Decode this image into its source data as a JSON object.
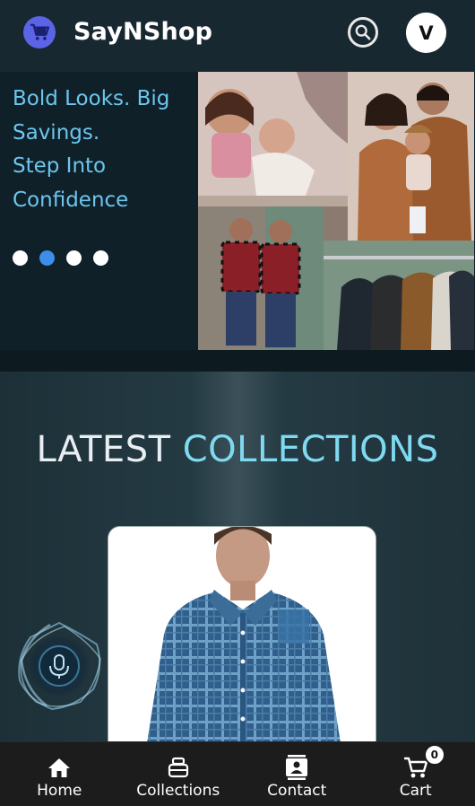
{
  "header": {
    "brand": "SayNShop",
    "avatar_initial": "V",
    "logo_icon": "cart-icon",
    "search_icon": "search-icon",
    "colors": {
      "logo_bg": "#5b63e6",
      "header_bg": "#172830"
    }
  },
  "hero": {
    "headline_lines": [
      "Bold Looks. Big",
      "Savings.",
      "Step Into",
      "Confidence"
    ],
    "carousel": {
      "slide_count": 4,
      "active_index": 1
    },
    "image_alt": "family-clothing-collage",
    "colors": {
      "headline": "#6cc6ee",
      "dot_active": "#3d8ee8",
      "dot": "#ffffff"
    }
  },
  "section": {
    "title_part1": "LATEST",
    "title_part2": "COLLECTIONS",
    "product_image": "blue-checked-shirt",
    "voice_icon": "microphone-icon",
    "colors": {
      "title_part1": "#e8eef2",
      "title_part2": "#7fd9ef"
    }
  },
  "nav": {
    "items": [
      {
        "label": "Home",
        "icon": "home-icon"
      },
      {
        "label": "Collections",
        "icon": "collections-icon"
      },
      {
        "label": "Contact",
        "icon": "contact-icon"
      },
      {
        "label": "Cart",
        "icon": "cart-icon"
      }
    ],
    "cart_count": "0"
  }
}
